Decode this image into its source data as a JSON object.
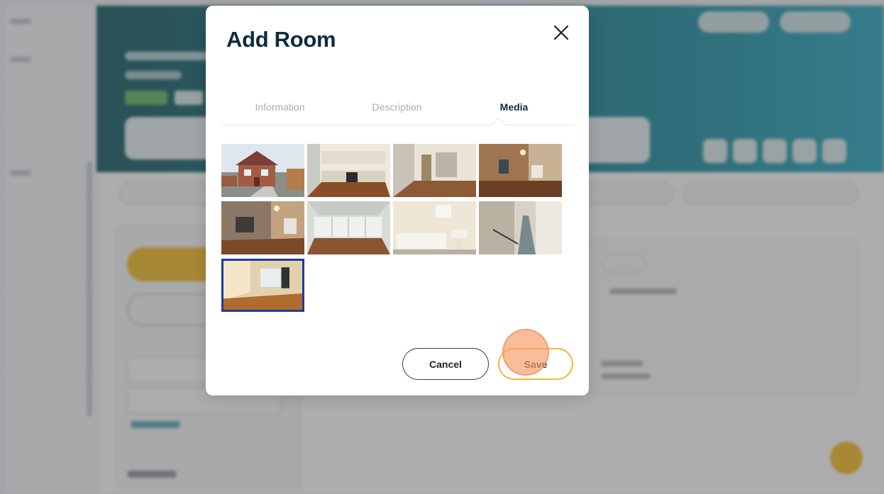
{
  "modal": {
    "title": "Add Room",
    "subtitle": "",
    "close_icon": "close-icon"
  },
  "tabs": [
    {
      "label": "Information",
      "active": false
    },
    {
      "label": "Description",
      "active": false
    },
    {
      "label": "Media",
      "active": true
    }
  ],
  "media": {
    "items": [
      {
        "depicts": "house-exterior",
        "selected": false
      },
      {
        "depicts": "kitchen",
        "selected": false
      },
      {
        "depicts": "empty-room-doorway",
        "selected": false
      },
      {
        "depicts": "living-room-fireplace",
        "selected": false
      },
      {
        "depicts": "living-room-window",
        "selected": false
      },
      {
        "depicts": "conservatory",
        "selected": false
      },
      {
        "depicts": "bathroom",
        "selected": false
      },
      {
        "depicts": "hallway-stairs",
        "selected": false
      },
      {
        "depicts": "bedroom",
        "selected": true
      }
    ],
    "selected_border_color": "#1e3aa0"
  },
  "actions": {
    "cancel_label": "Cancel",
    "save_label": "Save"
  },
  "colors": {
    "title": "#0d2b3e",
    "save_border": "#f2b93a",
    "banner": "#2f8fa0",
    "accent_yellow": "#f6c33c"
  }
}
